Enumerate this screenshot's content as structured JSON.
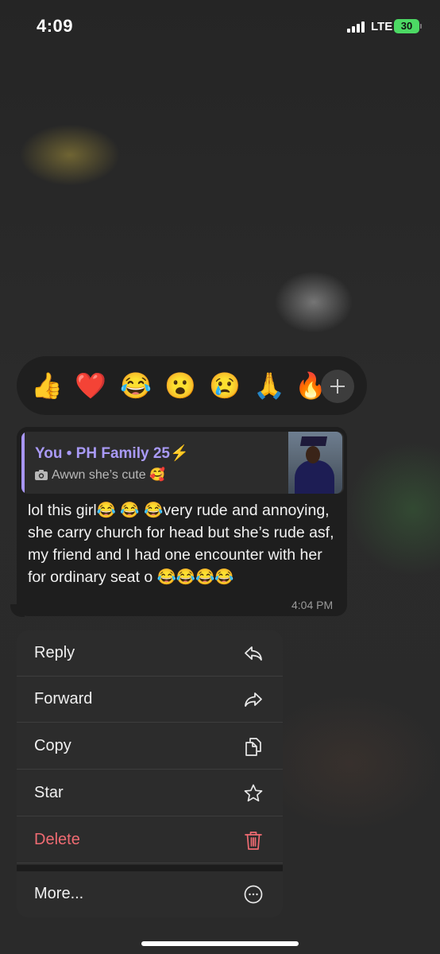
{
  "status_bar": {
    "time": "4:09",
    "network": "LTE",
    "battery": "30",
    "battery_color": "#4cd964"
  },
  "reactions": [
    {
      "emoji": "👍",
      "name": "thumbs-up"
    },
    {
      "emoji": "❤️",
      "name": "red-heart"
    },
    {
      "emoji": "😂",
      "name": "tears-of-joy"
    },
    {
      "emoji": "😮",
      "name": "surprised"
    },
    {
      "emoji": "😢",
      "name": "crying"
    },
    {
      "emoji": "🙏",
      "name": "folded-hands"
    },
    {
      "emoji": "🔥",
      "name": "fire"
    }
  ],
  "message": {
    "quote_author": "You • PH Family 25⚡",
    "quote_text": "Awwn she’s cute 🥰",
    "text": "lol this girl😂 😂 😂very rude and annoying, she carry church for head but she’s rude asf, my friend and I had one encounter with her for ordinary seat o 😂😂😂😂",
    "time": "4:04 PM"
  },
  "menu": {
    "reply": "Reply",
    "forward": "Forward",
    "copy": "Copy",
    "star": "Star",
    "delete": "Delete",
    "more": "More..."
  },
  "colors": {
    "accent_quote": "#a896f5",
    "danger": "#ef6b72"
  },
  "icons": [
    "reply-icon",
    "forward-icon",
    "copy-icon",
    "star-icon",
    "trash-icon",
    "more-icon",
    "camera-icon",
    "plus-icon"
  ]
}
